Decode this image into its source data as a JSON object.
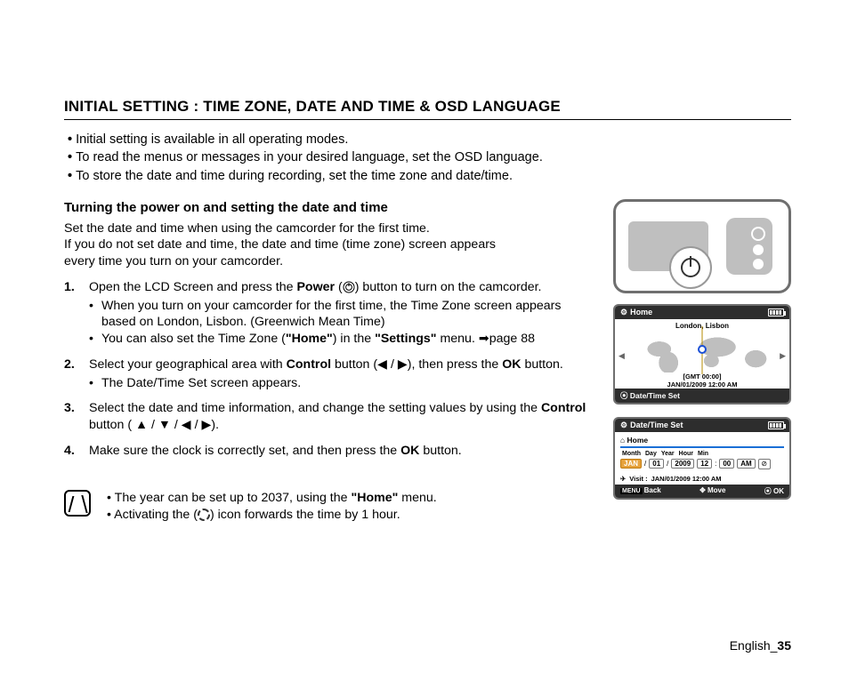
{
  "title": "INITIAL SETTING : TIME ZONE, DATE AND TIME & OSD LANGUAGE",
  "intro": [
    "Initial setting is available in all operating modes.",
    "To read the menus or messages in your desired language, set the OSD language.",
    "To store the date and time during recording, set the time zone and date/time."
  ],
  "subheading": "Turning the power on and setting the date and time",
  "lead": [
    "Set the date and time when using the camcorder for the first time.",
    "If you do not set date and time, the date and time (time zone) screen appears",
    "every time you turn on your camcorder."
  ],
  "steps": {
    "s1_a": "Open the LCD Screen and press the ",
    "s1_b": "Power",
    "s1_c": " button to turn on the camcorder.",
    "s1_sub1": "When you turn on your camcorder for the first time, the Time Zone screen appears based on London, Lisbon. (Greenwich Mean Time)",
    "s1_sub2a": "You can also set the Time Zone (",
    "s1_sub2b": "\"Home\"",
    "s1_sub2c": ") in the ",
    "s1_sub2d": "\"Settings\"",
    "s1_sub2e": " menu. ➡page 88",
    "s2_a": "Select your geographical area with ",
    "s2_b": "Control",
    "s2_c": " button (◀ / ▶), then press the ",
    "s2_d": "OK",
    "s2_e": " button.",
    "s2_sub1": "The Date/Time Set screen appears.",
    "s3_a": "Select the date and time information, and change the setting values by using the ",
    "s3_b": "Control",
    "s3_c": " button ( ▲ / ▼ / ◀ / ▶).",
    "s4_a": "Make sure the clock is correctly set, and then press the ",
    "s4_b": "OK",
    "s4_c": " button."
  },
  "notes": {
    "n1_a": "The year can be set up to 2037, using the ",
    "n1_b": "\"Home\"",
    "n1_c": " menu.",
    "n2": "Activating the ( ) icon forwards the time by 1 hour."
  },
  "lcd2": {
    "header": "Home",
    "city": "London, Lisbon",
    "gmt": "[GMT 00:00]",
    "dt": "JAN/01/2009 12:00 AM",
    "footer": "Date/Time Set"
  },
  "lcd3": {
    "header": "Date/Time Set",
    "home": "Home",
    "cols": [
      "Month",
      "Day",
      "Year",
      "Hour",
      "Min"
    ],
    "vals": {
      "month": "JAN",
      "day": "01",
      "year": "2009",
      "hour": "12",
      "min": "00",
      "ampm": "AM"
    },
    "visit_label": "Visit  :",
    "visit": "JAN/01/2009 12:00 AM",
    "back": "Back",
    "move": "Move",
    "ok": "OK"
  },
  "footer_a": "English_",
  "footer_b": "35"
}
